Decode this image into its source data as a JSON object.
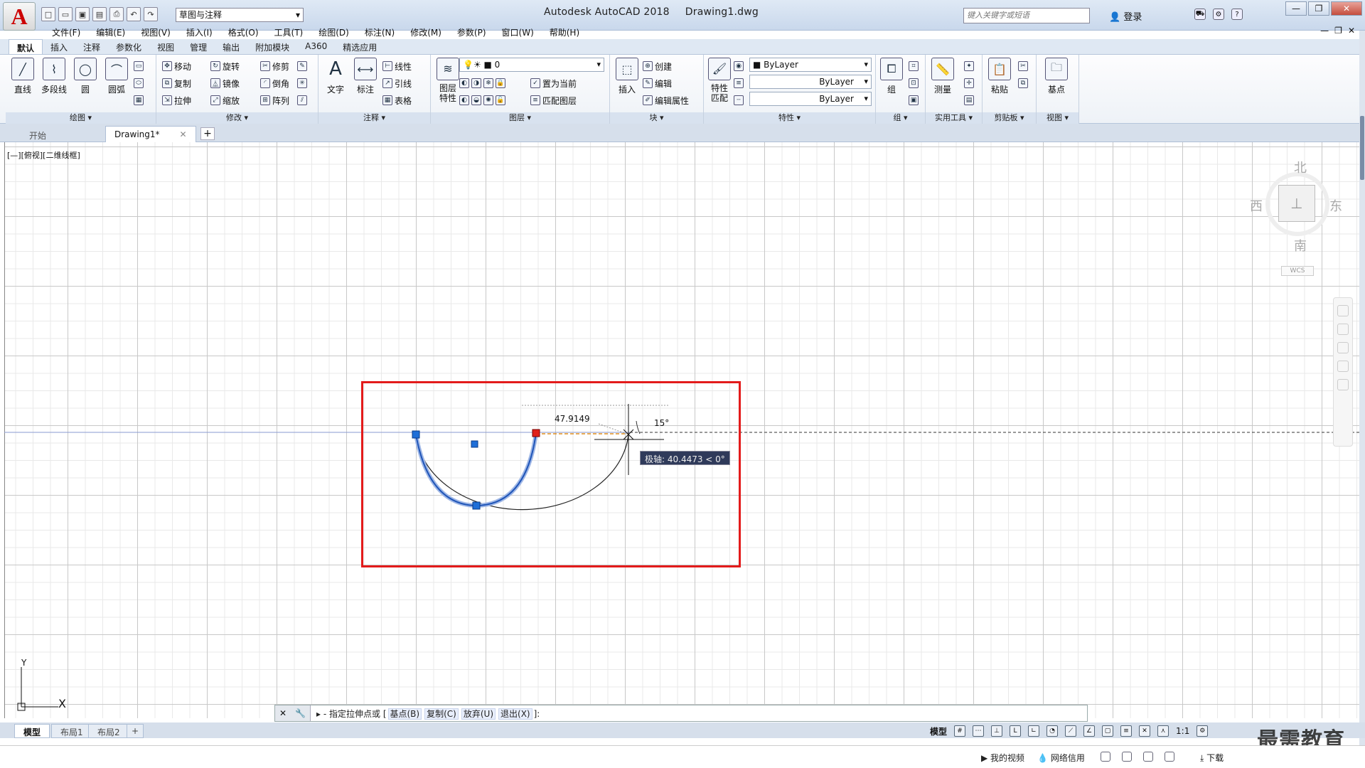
{
  "title": {
    "app_name": "Autodesk AutoCAD 2018",
    "file_name": "Drawing1.dwg"
  },
  "logo": {
    "letter": "A"
  },
  "workspace": "草图与注释",
  "search": {
    "placeholder": "键入关键字或短语"
  },
  "login": "登录",
  "menu": [
    "文件(F)",
    "编辑(E)",
    "视图(V)",
    "插入(I)",
    "格式(O)",
    "工具(T)",
    "绘图(D)",
    "标注(N)",
    "修改(M)",
    "参数(P)",
    "窗口(W)",
    "帮助(H)"
  ],
  "ribbon_tabs": [
    "默认",
    "插入",
    "注释",
    "参数化",
    "视图",
    "管理",
    "输出",
    "附加模块",
    "A360",
    "精选应用"
  ],
  "panels": {
    "draw": {
      "title": "绘图",
      "line": "直线",
      "polyline": "多段线",
      "circle": "圆",
      "arc": "圆弧"
    },
    "modify": {
      "title": "修改",
      "move": "移动",
      "rotate": "旋转",
      "trim": "修剪",
      "copy": "复制",
      "mirror": "镜像",
      "fillet": "倒角",
      "stretch": "拉伸",
      "scale": "缩放",
      "array": "阵列"
    },
    "annotation": {
      "title": "注释",
      "text": "文字",
      "dimension": "标注",
      "linear": "线性",
      "leader": "引线",
      "table": "表格"
    },
    "layers": {
      "title": "图层",
      "layer_props": "图层\n特性",
      "layer_value": "0",
      "set_current": "置为当前",
      "match_layer": "匹配图层"
    },
    "block": {
      "title": "块",
      "insert": "插入",
      "create": "创建",
      "edit": "编辑",
      "edit_attr": "编辑属性"
    },
    "properties": {
      "title": "特性",
      "match": "特性\n匹配",
      "color": "ByLayer",
      "linetype": "ByLayer",
      "lineweight": "ByLayer"
    },
    "groups": {
      "title": "组",
      "group": "组"
    },
    "utilities": {
      "title": "实用工具",
      "measure": "测量"
    },
    "clipboard": {
      "title": "剪贴板",
      "paste": "粘贴"
    },
    "view": {
      "title": "视图",
      "base": "基点"
    }
  },
  "doc_tabs": {
    "start": "开始",
    "drawing": "Drawing1*"
  },
  "view_label": "[—][俯视][二维线框]",
  "viewcube": {
    "north": "北",
    "south": "南",
    "east": "东",
    "west": "西",
    "wcs": "WCS"
  },
  "drawing": {
    "dimension": "47.9149",
    "angle": "15°",
    "tooltip": "极轴: 40.4473 < 0°"
  },
  "ucs": {
    "x": "X",
    "y": "Y"
  },
  "command": {
    "prompt": "指定拉伸点或",
    "opt1": "基点(B)",
    "opt2": "复制(C)",
    "opt3": "放弃(U)",
    "opt4": "退出(X)",
    "end": "]:"
  },
  "layout_tabs": [
    "模型",
    "布局1",
    "布局2"
  ],
  "status": {
    "model": "模型",
    "scale": "1:1"
  },
  "watermark": "最需教育",
  "taskbar": {
    "video": "我的视频",
    "network": "网络信用",
    "download": "下载"
  },
  "colors": {
    "accent": "#e31b1b",
    "selection": "#1f55b8",
    "tooltip_bg": "#2f3a5a"
  }
}
